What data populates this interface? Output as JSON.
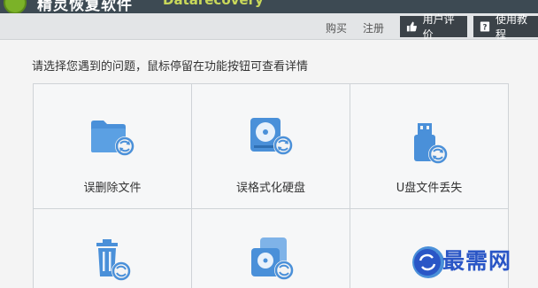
{
  "app": {
    "title": "精灵恢复软件",
    "subtitle": "Datarecovery"
  },
  "toolbar": {
    "buy_label": "购买",
    "register_label": "注册",
    "review_label": "用户评价",
    "tutorial_label": "使用教程"
  },
  "prompt": "请选择您遇到的问题，鼠标停留在功能按钮可查看详情",
  "options": [
    {
      "label": "误删除文件",
      "icon": "folder-recover-icon"
    },
    {
      "label": "误格式化硬盘",
      "icon": "harddisk-recover-icon"
    },
    {
      "label": "U盘文件丢失",
      "icon": "usb-recover-icon"
    },
    {
      "label": "",
      "icon": "recycle-bin-recover-icon"
    },
    {
      "label": "",
      "icon": "partition-recover-icon"
    },
    {
      "label": "",
      "icon": "recover-icon"
    }
  ],
  "watermark": "最需网",
  "colors": {
    "icon_blue": "#4a90d9",
    "dark_bar": "#3b4248",
    "watermark_blue": "#2a56c6"
  }
}
